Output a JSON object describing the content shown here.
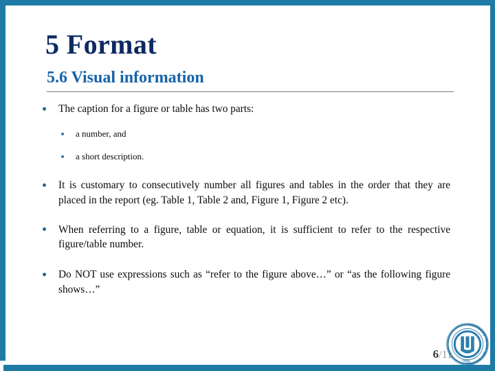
{
  "slide": {
    "title": "5 Format",
    "subtitle": "5.6 Visual information",
    "accent_color": "#1d7ba5",
    "title_color": "#0e2a63",
    "subtitle_color": "#1763a8",
    "bullet_color": "#22688c",
    "background": "#ffffff"
  },
  "content": {
    "bullets": [
      {
        "level": 1,
        "text": "The caption for a figure or table has two parts:"
      },
      {
        "level": 2,
        "text": "a number, and"
      },
      {
        "level": 2,
        "text": "a short description."
      },
      {
        "level": 1,
        "text": "It is customary to consecutively number all figures and tables in the order that they are placed in the report (eg. Table 1, Table 2 and, Figure 1, Figure 2 etc)."
      },
      {
        "level": 1,
        "text": "When referring to a figure, table or equation, it is sufficient to refer to the respective figure/table number."
      },
      {
        "level": 1,
        "text": "Do NOT use expressions such as “refer to the figure above…” or “as the following figure shows…”"
      }
    ]
  },
  "footer": {
    "current_page": "6",
    "page_separator_total": "/11",
    "logo": {
      "name": "university-seal-logo",
      "ring_text": "KARADENIZ TEKNIK UNIVERSITESI",
      "year": "1955",
      "color": "#1f6f9e"
    }
  }
}
